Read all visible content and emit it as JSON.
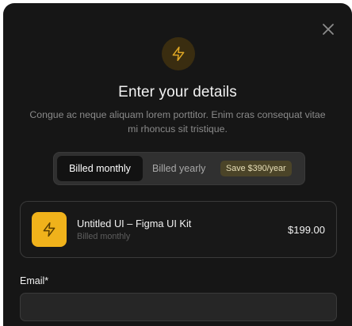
{
  "modal": {
    "title": "Enter your details",
    "subtitle": "Congue ac neque aliquam lorem porttitor. Enim cras consequat vitae mi rhoncus sit tristique.",
    "close_icon": "close-icon",
    "header_icon": "lightning-icon"
  },
  "billing_toggle": {
    "monthly_label": "Billed monthly",
    "yearly_label": "Billed yearly",
    "save_badge": "Save $390/year",
    "selected": "monthly"
  },
  "plan": {
    "icon": "lightning-icon",
    "name": "Untitled UI – Figma UI Kit",
    "billing": "Billed monthly",
    "price": "$199.00"
  },
  "email": {
    "label": "Email*",
    "value": "",
    "placeholder": ""
  },
  "colors": {
    "background": "#161616",
    "accent": "#f0b21b",
    "accent_dark": "#3a2d10",
    "badge_bg": "#4b4428"
  }
}
